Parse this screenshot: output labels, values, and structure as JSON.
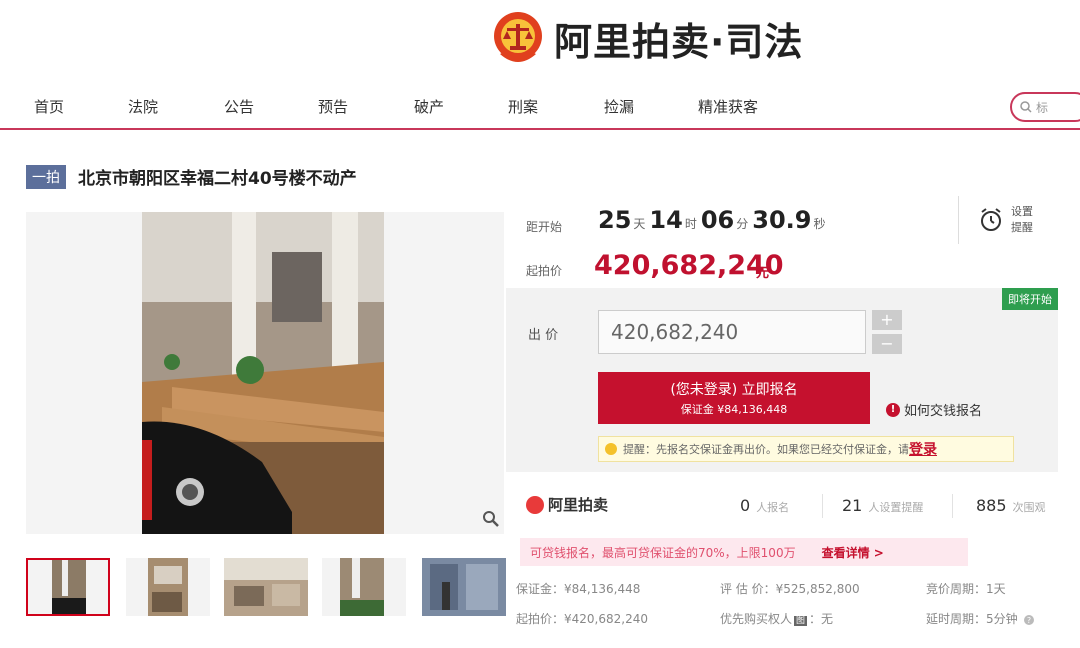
{
  "logo": {
    "text": "阿里拍卖·司法"
  },
  "nav": {
    "items": [
      "首页",
      "法院",
      "公告",
      "预告",
      "破产",
      "刑案",
      "捡漏",
      "精准获客"
    ],
    "search_placeholder": "标"
  },
  "item": {
    "tag": "一拍",
    "title": "北京市朝阳区幸福二村40号楼不动产"
  },
  "countdown": {
    "label": "距开始",
    "days": "25",
    "days_unit": "天",
    "hours": "14",
    "hours_unit": "时",
    "minutes": "06",
    "minutes_unit": "分",
    "seconds": "30.9",
    "seconds_unit": "秒"
  },
  "price": {
    "label": "起拍价",
    "value": "420,682,240",
    "unit": "元"
  },
  "remind": {
    "line1": "设置",
    "line2": "提醒"
  },
  "bid": {
    "status": "即将开始",
    "label": "出  价",
    "value": "420,682,240",
    "plus": "+",
    "minus": "−",
    "signup_line1": "(您未登录) 立即报名",
    "signup_line2": "保证金 ¥84,136,448",
    "how_pay": "如何交钱报名",
    "tip_text": "提醒：先报名交保证金再出价。如果您已经交付保证金，请",
    "tip_login": "登录"
  },
  "stats": {
    "brand": "阿里拍卖",
    "signups": "0",
    "signups_label": "人报名",
    "reminders": "21",
    "reminders_label": "人设置提醒",
    "views": "885",
    "views_label": "次围观"
  },
  "promo": {
    "text": "可贷钱报名，最高可贷保证金的70%，上限100万",
    "link": "查看详情 >"
  },
  "details": {
    "deposit": "保证金：¥84,136,448",
    "assessed": "评 估 价：¥525,852,800",
    "bid_cycle": "竞价周期：1天",
    "start_price": "起拍价：¥420,682,240",
    "priority": "优先购买权人",
    "priority_badge": "图",
    "priority_value": "：无",
    "delay": "延时周期：5分钟"
  },
  "colors": {
    "accent": "#c5112e",
    "nav_underline": "#c8375a",
    "status": "#2e9e4f"
  }
}
